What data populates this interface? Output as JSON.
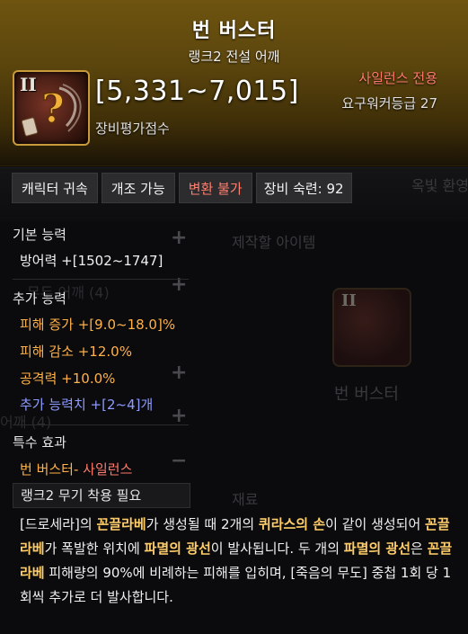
{
  "background": {
    "tab_partial": "옥빛 환영",
    "panel_title": "제작할 아이템",
    "item_name": "번 버스터",
    "section_material": "재료",
    "list_partial_1": "무두 어깨 (4)",
    "list_partial_2": "어깨 (4)",
    "list_partial_3": "어깨 (4)"
  },
  "header": {
    "title": "번 버스터",
    "subtitle": "랭크2 전설 어깨",
    "icon": {
      "name": "rank2-shoulder-item-icon",
      "rank_numeral": "II"
    },
    "score": "[5,331~7,015]",
    "score_label": "장비평가점수",
    "class_restriction": "사일런스 전용",
    "required_level": "요구워커등급 27"
  },
  "tags": [
    "캐릭터 귀속",
    "개조 가능",
    "변환 불가",
    "장비 숙련: 92"
  ],
  "basic": {
    "heading": "기본 능력",
    "defense": "방어력  +[1502~1747]"
  },
  "extra": {
    "heading": "추가 능력",
    "lines": [
      {
        "text": "피해 증가  +[9.0~18.0]%",
        "color": "#ffb14a"
      },
      {
        "text": "피해 감소  +12.0%",
        "color": "#ffb14a"
      },
      {
        "text": "공격력  +10.0%",
        "color": "#ffb14a"
      },
      {
        "text": "추가 능력치 +[2~4]개",
        "color": "#8e9bff"
      }
    ]
  },
  "special": {
    "heading": "특수 효과",
    "effect_name": "번 버스터",
    "effect_sep": "-",
    "effect_class": "사일런스",
    "requirement": "랭크2 무기 착용 필요",
    "desc": {
      "p1": "[드로세라]",
      "p2": "의 ",
      "p3": "꼰끌라베",
      "p4": "가 생성될 때 2개의 ",
      "p5": "퀴라스의 손",
      "p6": "이 같이 생성되어 ",
      "p7": "꼰끌라베",
      "p8": "가 폭발한 위치에 ",
      "p9": "파멸의 광선",
      "p10": "이 발사됩니다. 두 개의 ",
      "p11": "파멸의 광선",
      "p12": "은 ",
      "p13": "꼰끌라베",
      "p14": " 피해량의 90%에 비례하는 피해를 입히며, [죽음의 무도] 중첩 1회 당 1회씩 추가로 더 발사합니다."
    }
  }
}
